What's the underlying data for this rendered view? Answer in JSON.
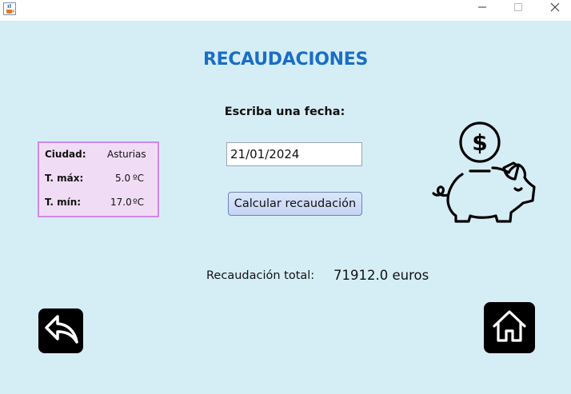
{
  "window": {
    "icons": {
      "app": "java-cup-icon",
      "minimize": "minimize-icon",
      "maximize": "maximize-icon",
      "close": "close-icon"
    }
  },
  "main": {
    "title": "RECAUDACIONES",
    "prompt": "Escriba una fecha:",
    "date_value": "21/01/2024",
    "calc_button": "Calcular recaudación",
    "total_label": "Recaudación total:",
    "total_value": "71912.0 euros"
  },
  "weather": {
    "city_label": "Ciudad:",
    "city_value": "Asturias",
    "max_label": "T. máx:",
    "max_value": "5.0",
    "min_label": "T. mín:",
    "min_value": "17.0",
    "unit": "ºC"
  },
  "icons": {
    "piggy": "piggy-bank-icon",
    "back": "back-arrow-icon",
    "home": "home-icon"
  },
  "colors": {
    "background": "#d5eef6",
    "title": "#1a6ec5",
    "weather_bg": "#f1dcf5",
    "weather_border": "#cf88e8",
    "button_bg": "#c5d4f3"
  }
}
